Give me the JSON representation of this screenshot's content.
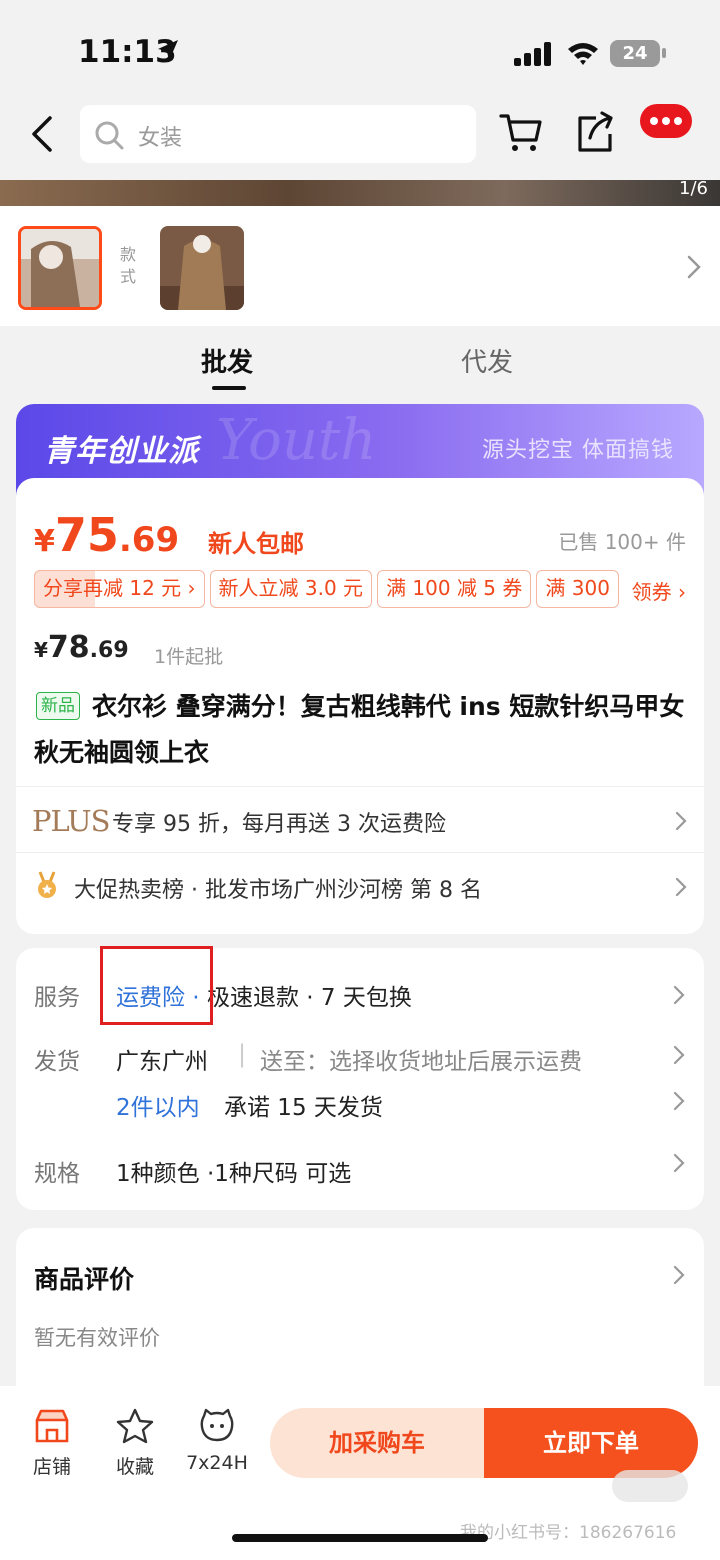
{
  "status_bar": {
    "time": "11:13",
    "battery": "24"
  },
  "nav": {
    "search_placeholder": "女装"
  },
  "gallery": {
    "counter": "1/6"
  },
  "styles": {
    "label": "款式"
  },
  "tabs": [
    {
      "label": "批发"
    },
    {
      "label": "代发"
    }
  ],
  "banner": {
    "title": "青年创业派",
    "slogan": "源头挖宝  体面搞钱"
  },
  "price": {
    "yen": "¥",
    "integer": "75",
    "decimal": ".69",
    "free_shipping": "新人包邮",
    "sold": "已售 100+ 件",
    "coupons": [
      "分享再减 12 元 ›",
      "新人立减 3.0 元",
      "满 100 减 5 券",
      "满 300"
    ],
    "get_coupon": "领券 ›",
    "old_integer": "78",
    "old_decimal": ".69",
    "min_batch": "1件起批"
  },
  "product": {
    "badge": "新品",
    "title": "衣尔衫 叠穿满分！复古粗线韩代 ins 短款针织马甲女秋无袖圆领上衣"
  },
  "plus": {
    "logo": "PLUS",
    "text": "专享 95 折，每月再送 3 次运费险"
  },
  "rank": {
    "text": "大促热卖榜 · 批发市场广州沙河榜  第 8 名"
  },
  "service": {
    "label": "服务",
    "item1": "运费险",
    "sep": " · ",
    "item2": "极速退款 · 7 天包换",
    "ship_label": "发货",
    "ship_from": "广东广州",
    "ship_to": "送至：选择收货地址后展示运费",
    "qty": "2件以内",
    "promise": "承诺 15 天发货",
    "spec_label": "规格",
    "spec_value": "1种颜色 ·1种尺码 可选"
  },
  "review": {
    "title": "商品评价",
    "empty": "暂无有效评价"
  },
  "bottom": {
    "shop": "店铺",
    "fav": "收藏",
    "service": "7x24H",
    "add_cart": "加采购车",
    "buy_now": "立即下单",
    "watermark": "我的小红书号：186267616"
  },
  "colors": {
    "accent": "#f0481c",
    "blue": "#2f72d9",
    "green": "#2cb44a",
    "highlight": "#e02020"
  }
}
